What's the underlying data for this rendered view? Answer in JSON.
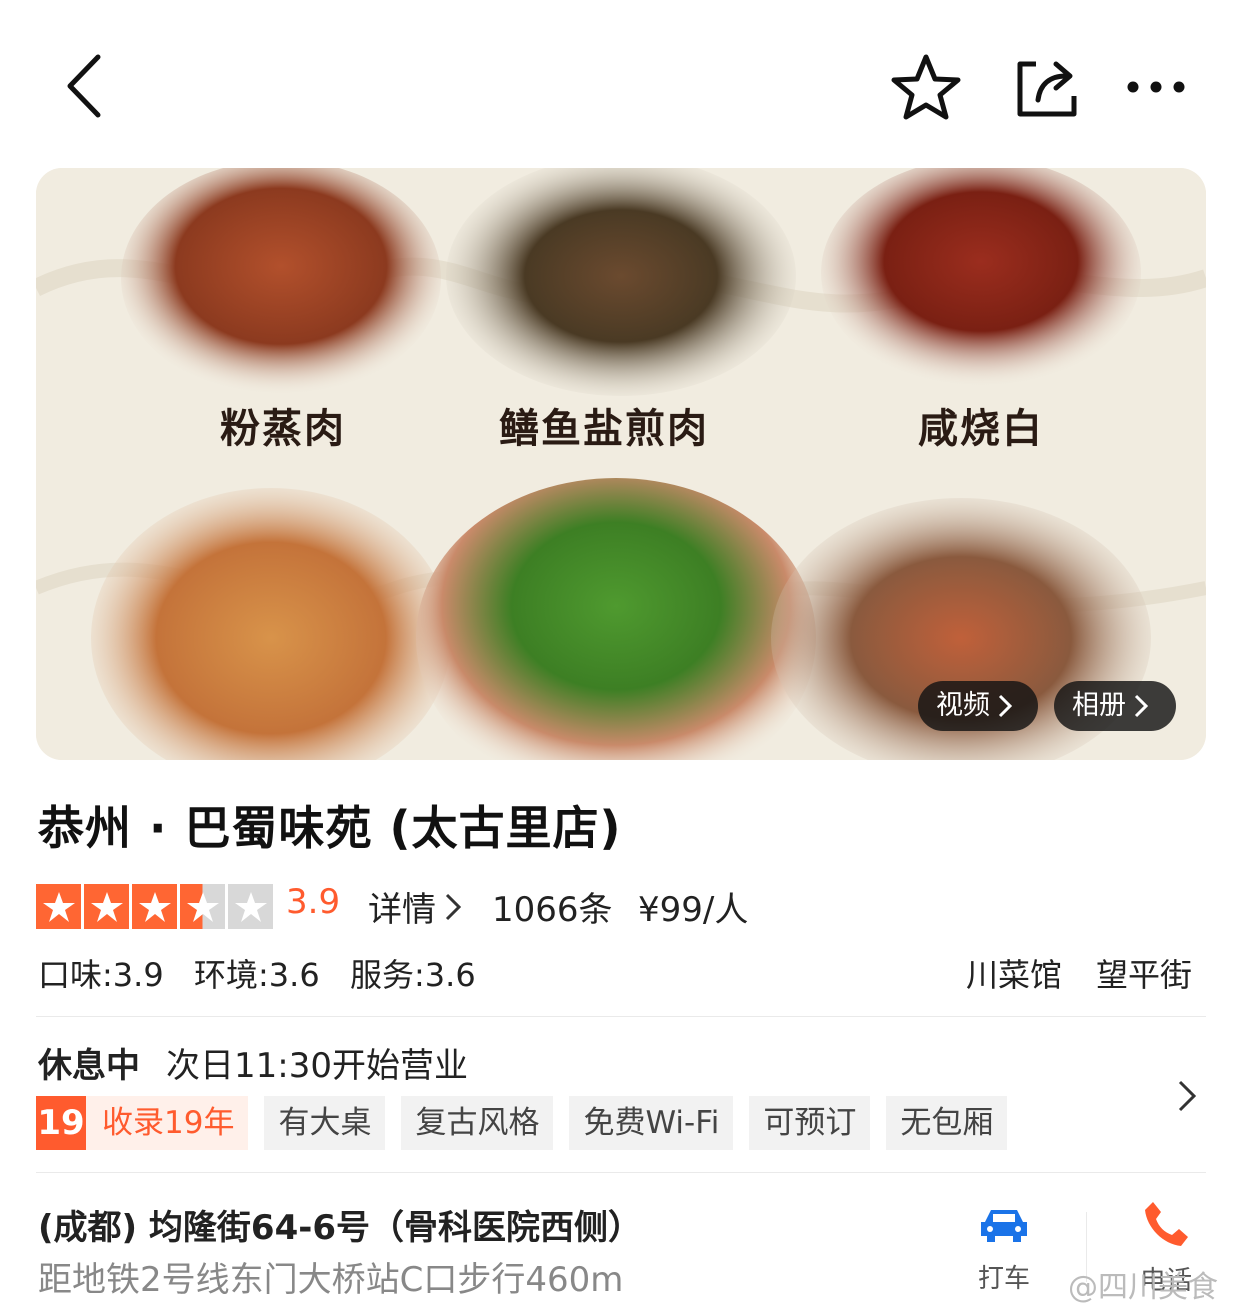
{
  "colors": {
    "accent": "#ff5b2e",
    "star": "#ff6633",
    "car": "#1a73e8",
    "phone": "#ff5b2e"
  },
  "top_bar": {
    "back_icon": "chevron-left-icon",
    "favorite_icon": "star-outline-icon",
    "share_icon": "share-icon",
    "more_icon": "more-dots-icon"
  },
  "hero": {
    "dishes": [
      "粉蒸肉",
      "鳝鱼盐煎肉",
      "咸烧白"
    ],
    "video_label": "视频",
    "album_label": "相册"
  },
  "shop": {
    "name": "恭州 · 巴蜀味苑 (太古里店)",
    "stars": 3.5,
    "score": "3.9",
    "details_label": "详情",
    "reviews": "1066条",
    "price": "¥99/人",
    "taste": "口味:3.9",
    "environment": "环境:3.6",
    "service": "服务:3.6",
    "category": "川菜馆",
    "area": "望平街"
  },
  "hours": {
    "status": "休息中",
    "text": "次日11:30开始营业"
  },
  "tags": {
    "badge_number": "19",
    "badge_text": "收录19年",
    "items": [
      "有大桌",
      "复古风格",
      "免费Wi-Fi",
      "可预订",
      "无包厢"
    ]
  },
  "location": {
    "address": "(成都) 均隆街64-6号（骨科医院西侧）",
    "distance": "距地铁2号线东门大桥站C口步行460m",
    "taxi_label": "打车",
    "phone_label": "电话"
  },
  "watermark": "@四川美食"
}
